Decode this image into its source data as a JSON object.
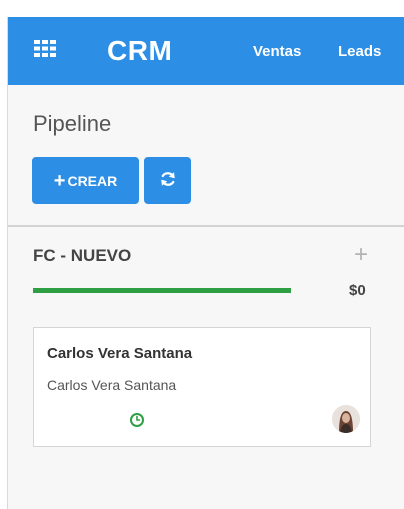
{
  "topbar": {
    "brand": "CRM",
    "nav": [
      "Ventas",
      "Leads"
    ],
    "apps_icon": "apps-grid-icon",
    "color": "#2d8ee6"
  },
  "page": {
    "title": "Pipeline",
    "create_label": "CREAR",
    "create_icon": "plus-icon",
    "refresh_icon": "refresh-icon"
  },
  "column": {
    "title": "FC - NUEVO",
    "add_icon": "plus-icon",
    "total": "$0",
    "progress": 1.0,
    "progress_color": "#2ea043"
  },
  "cards": [
    {
      "title": "Carlos Vera Santana",
      "subtitle": "Carlos Vera Santana",
      "activity_icon": "clock-icon",
      "activity_color": "#2ea043",
      "avatar": "user-avatar"
    }
  ]
}
